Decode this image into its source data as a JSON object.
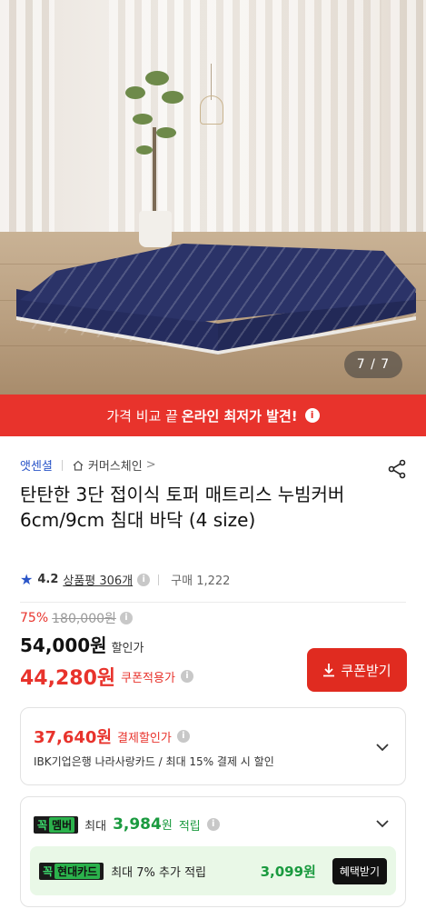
{
  "hero": {
    "image_counter": "7 / 7"
  },
  "promo": {
    "prefix": "가격 비교 끝",
    "highlight": "온라인 최저가 발견!",
    "icon": "info-icon"
  },
  "brand": {
    "name": "앳센셜",
    "store": "커머스체인",
    "store_chevron": ">"
  },
  "product": {
    "title": "탄탄한 3단 접이식 토퍼 매트리스 누빔커버 6cm/9cm 침대 바닥 (4 size)"
  },
  "rating": {
    "score": "4.2",
    "reviews": "상품평 306개",
    "purchases": "구매 1,222"
  },
  "pricing": {
    "discount_pct": "75%",
    "original_price": "180,000원",
    "sale_price": "54,000원",
    "sale_label": "할인가",
    "coupon_price": "44,280원",
    "coupon_label": "쿠폰적용가",
    "coupon_button": "쿠폰받기"
  },
  "payment_card": {
    "amount": "37,640원",
    "label": "결제할인가",
    "description": "IBK기업은행 나라사랑카드 / 최대 15% 결제 시 할인"
  },
  "member_card": {
    "hook": "꼭",
    "badge": "멤버",
    "max_label": "최대",
    "points": "3,984",
    "unit": "원",
    "earn_label": "적립",
    "hyundai": {
      "hook": "꼭",
      "badge": "현대카드",
      "message": "최대 7% 추가 적립",
      "value": "3,099원",
      "button": "혜택받기"
    }
  },
  "colors": {
    "accent_red": "#e8332c",
    "brand_blue": "#2a55c8",
    "green": "#1a9a3f"
  }
}
